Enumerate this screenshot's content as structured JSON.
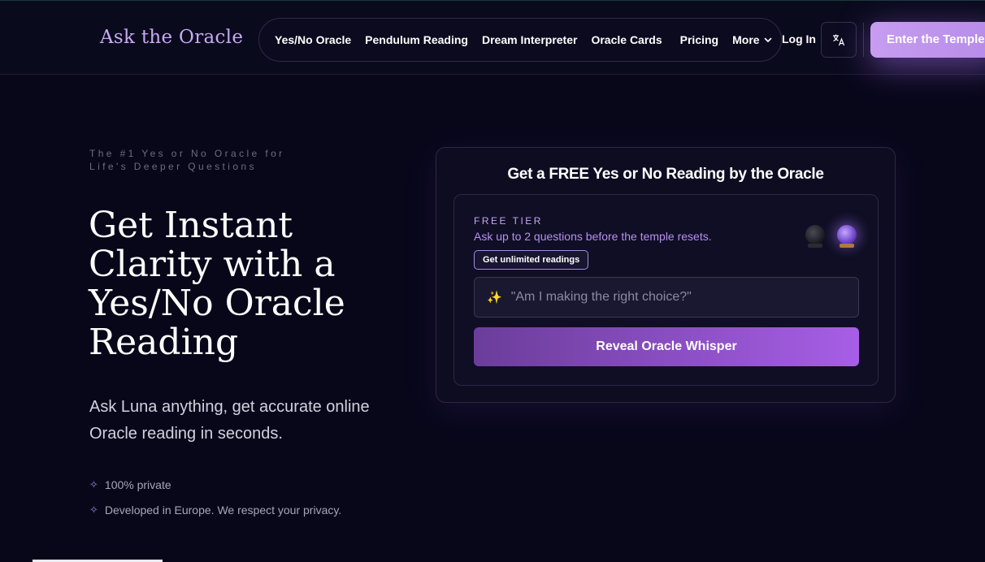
{
  "header": {
    "brand": "Ask the Oracle",
    "nav": [
      {
        "label": "Yes/No Oracle"
      },
      {
        "label": "Pendulum Reading"
      },
      {
        "label": "Dream Interpreter"
      },
      {
        "label": "Oracle Cards"
      },
      {
        "label": "Pricing"
      }
    ],
    "more_label": "More",
    "login_label": "Log In",
    "language_icon": "translate-icon",
    "cta_label": "Enter the Temple"
  },
  "hero": {
    "eyebrow": "The #1 Yes or No Oracle for Life's Deeper Questions",
    "headline": "Get Instant Clarity with a Yes/No Oracle Reading",
    "subtext": "Ask Luna anything, get accurate online Oracle reading in seconds.",
    "features": [
      "100% private",
      "Developed in Europe. We respect your privacy."
    ]
  },
  "card": {
    "title": "Get a FREE Yes or No Reading by the Oracle",
    "tier_label": "FREE TIER",
    "tier_desc": "Ask up to 2 questions before the temple resets.",
    "unlimited_label": "Get unlimited readings",
    "questions_used": 1,
    "questions_total": 2,
    "question_placeholder": "\"Am I making the right choice?\"",
    "question_value": "",
    "reveal_label": "Reveal Oracle Whisper"
  },
  "colors": {
    "background": "#08071a",
    "accent": "#a75ee6",
    "brand": "#c9a9f2"
  }
}
